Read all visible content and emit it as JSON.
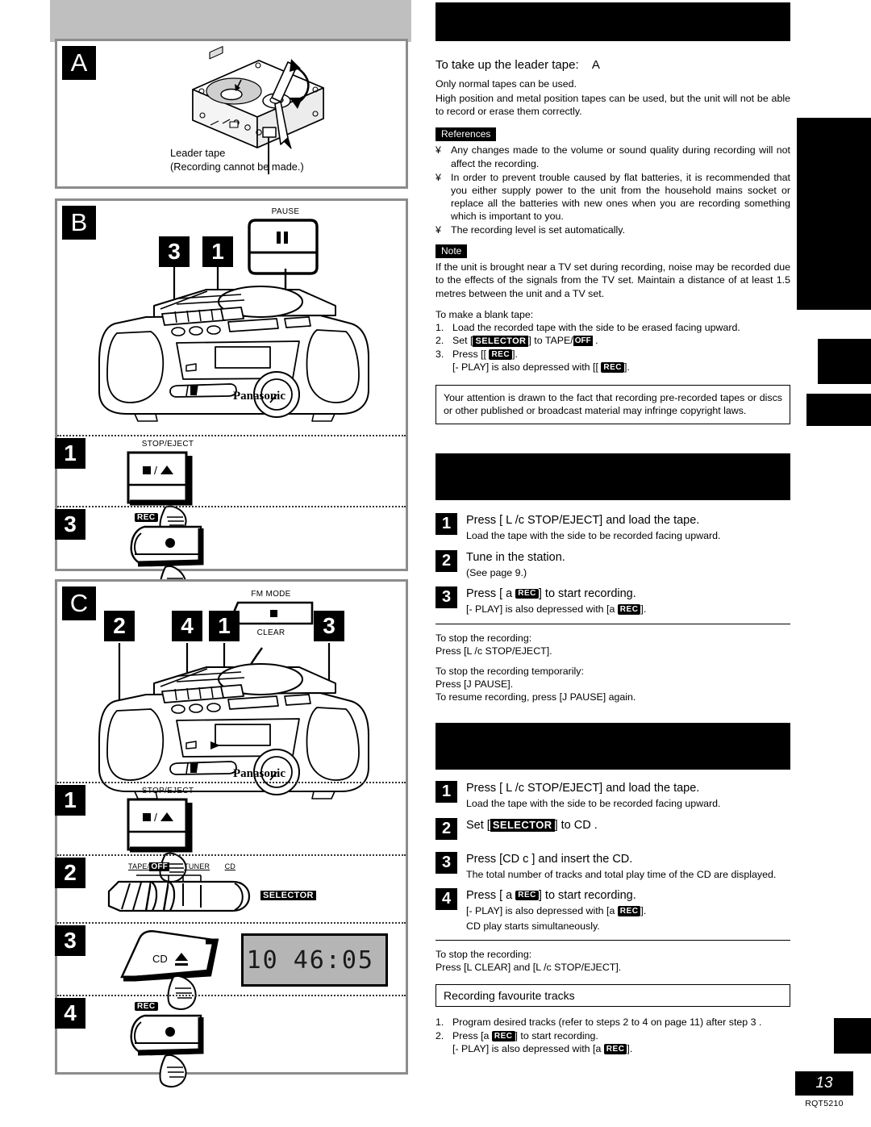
{
  "page": {
    "number": "13",
    "doc_code": "RQT5210"
  },
  "figures": {
    "a": {
      "letter": "A",
      "caption_line1": "Leader tape",
      "caption_line2": "(Recording cannot be made.)"
    },
    "b": {
      "letter": "B",
      "pause_label": "PAUSE",
      "callouts": [
        "3",
        "1"
      ],
      "brand": "Panasonic",
      "steps": [
        {
          "num": "1",
          "label": "STOP/EJECT",
          "glyph": "■ / ▲"
        },
        {
          "num": "3",
          "label": "REC",
          "glyph": "●"
        }
      ]
    },
    "c": {
      "letter": "C",
      "fm_mode_label": "FM MODE",
      "clear_label": "CLEAR",
      "callouts": [
        "2",
        "4",
        "1",
        "3"
      ],
      "brand": "Panasonic",
      "steps": [
        {
          "num": "1",
          "label": "STOP/EJECT",
          "glyph": "■ / ▲"
        },
        {
          "num": "2",
          "label": "SELECTOR",
          "positions": [
            "TAPE/",
            "OFF",
            "TUNER",
            "CD"
          ]
        },
        {
          "num": "3",
          "label": "CD ▲"
        },
        {
          "num": "4",
          "label": "REC",
          "glyph": "●"
        }
      ],
      "lcd": {
        "tracks": "10",
        "time": "46:05"
      }
    }
  },
  "content": {
    "leader": {
      "title": "To take up the leader tape:",
      "title_ref": "A",
      "p1": "Only normal tapes can be used.",
      "p2": "High position and metal position tapes can be used, but the unit will not be able to record or erase them correctly."
    },
    "references": {
      "label": "References",
      "bullet_mark": "¥",
      "items": [
        "Any changes made to the volume or sound quality during recording will not affect the recording.",
        "In order to prevent trouble caused by flat batteries, it is recommended that you either supply power to the unit from the household mains socket or replace all the batteries with new ones when you are recording something which is important to you.",
        "The recording level is set automatically."
      ]
    },
    "note": {
      "label": "Note",
      "text": "If the unit is brought near a TV set during recording, noise may be recorded due to the effects of the signals from the TV set. Maintain a distance of at least 1.5 metres between the unit and a TV set."
    },
    "blank_tape": {
      "title": "To make a blank tape:",
      "items": [
        {
          "n": "1.",
          "pre": "Load the recorded tape with the side to be erased facing upward.",
          "post": ""
        },
        {
          "n": "2.",
          "pre": "Set [",
          "badge": "SELECTOR",
          "mid": "] to  TAPE/",
          "badge2": "OFF",
          "post": " ."
        },
        {
          "n": "3.",
          "pre": "Press [[   ",
          "badge": "REC",
          "post": "]."
        }
      ],
      "also": {
        "pre": "[-   PLAY] is also depressed with [[   ",
        "badge": "REC",
        "post": "]."
      }
    },
    "copyright": "Your attention is drawn to the fact that recording pre-recorded tapes or discs or other published or broadcast material may infringe copyright laws.",
    "radio_section": {
      "header": "",
      "steps": [
        {
          "num": "1",
          "main": "Press [ L /c  STOP/EJECT] and load the tape.",
          "sub": "Load the tape with the side to be recorded facing upward."
        },
        {
          "num": "2",
          "main": "Tune in the station.",
          "sub": "(See page 9.)"
        },
        {
          "num": "3",
          "main_pre": "Press [ a  ",
          "main_badge": "REC",
          "main_post": "] to start recording.",
          "sub_pre": "[-   PLAY] is also depressed with [a  ",
          "sub_badge": "REC",
          "sub_post": "]."
        }
      ],
      "stop_title": "To stop the recording:",
      "stop_text": "Press [L /c  STOP/EJECT].",
      "pause_title": "To stop the recording temporarily:",
      "pause_text": "Press [J  PAUSE].",
      "resume_text": "To resume recording, press [J  PAUSE] again."
    },
    "cd_section": {
      "header": "",
      "steps": [
        {
          "num": "1",
          "main": "Press [ L /c  STOP/EJECT] and load the tape.",
          "sub": "Load the tape with the side to be recorded facing upward."
        },
        {
          "num": "2",
          "main_pre": "Set [",
          "main_badge": "SELECTOR",
          "main_post": "] to  CD ."
        },
        {
          "num": "3",
          "main": "Press [CD  c ] and insert the CD.",
          "sub": "The total number of tracks and total play time of the CD are displayed."
        },
        {
          "num": "4",
          "main_pre": "Press [ a  ",
          "main_badge": "REC",
          "main_post": "] to start recording.",
          "sub_pre": "[-   PLAY] is also depressed with [a  ",
          "sub_badge": "REC",
          "sub_post": "].",
          "sub2": "CD play starts simultaneously."
        }
      ],
      "stop_title": "To stop the recording:",
      "stop_text": "Press [L  CLEAR] and [L /c  STOP/EJECT].",
      "favourite_title": "Recording favourite tracks",
      "favourite_items": [
        {
          "n": "1.",
          "text": "Program desired tracks (refer to steps 2  to 4  on page 11) after step 3 ."
        },
        {
          "n": "2.",
          "pre": "Press [a  ",
          "badge": "REC",
          "post": "] to start recording."
        }
      ],
      "favourite_also": {
        "pre": "[-   PLAY] is also depressed with [a  ",
        "badge": "REC",
        "post": "]."
      }
    }
  }
}
